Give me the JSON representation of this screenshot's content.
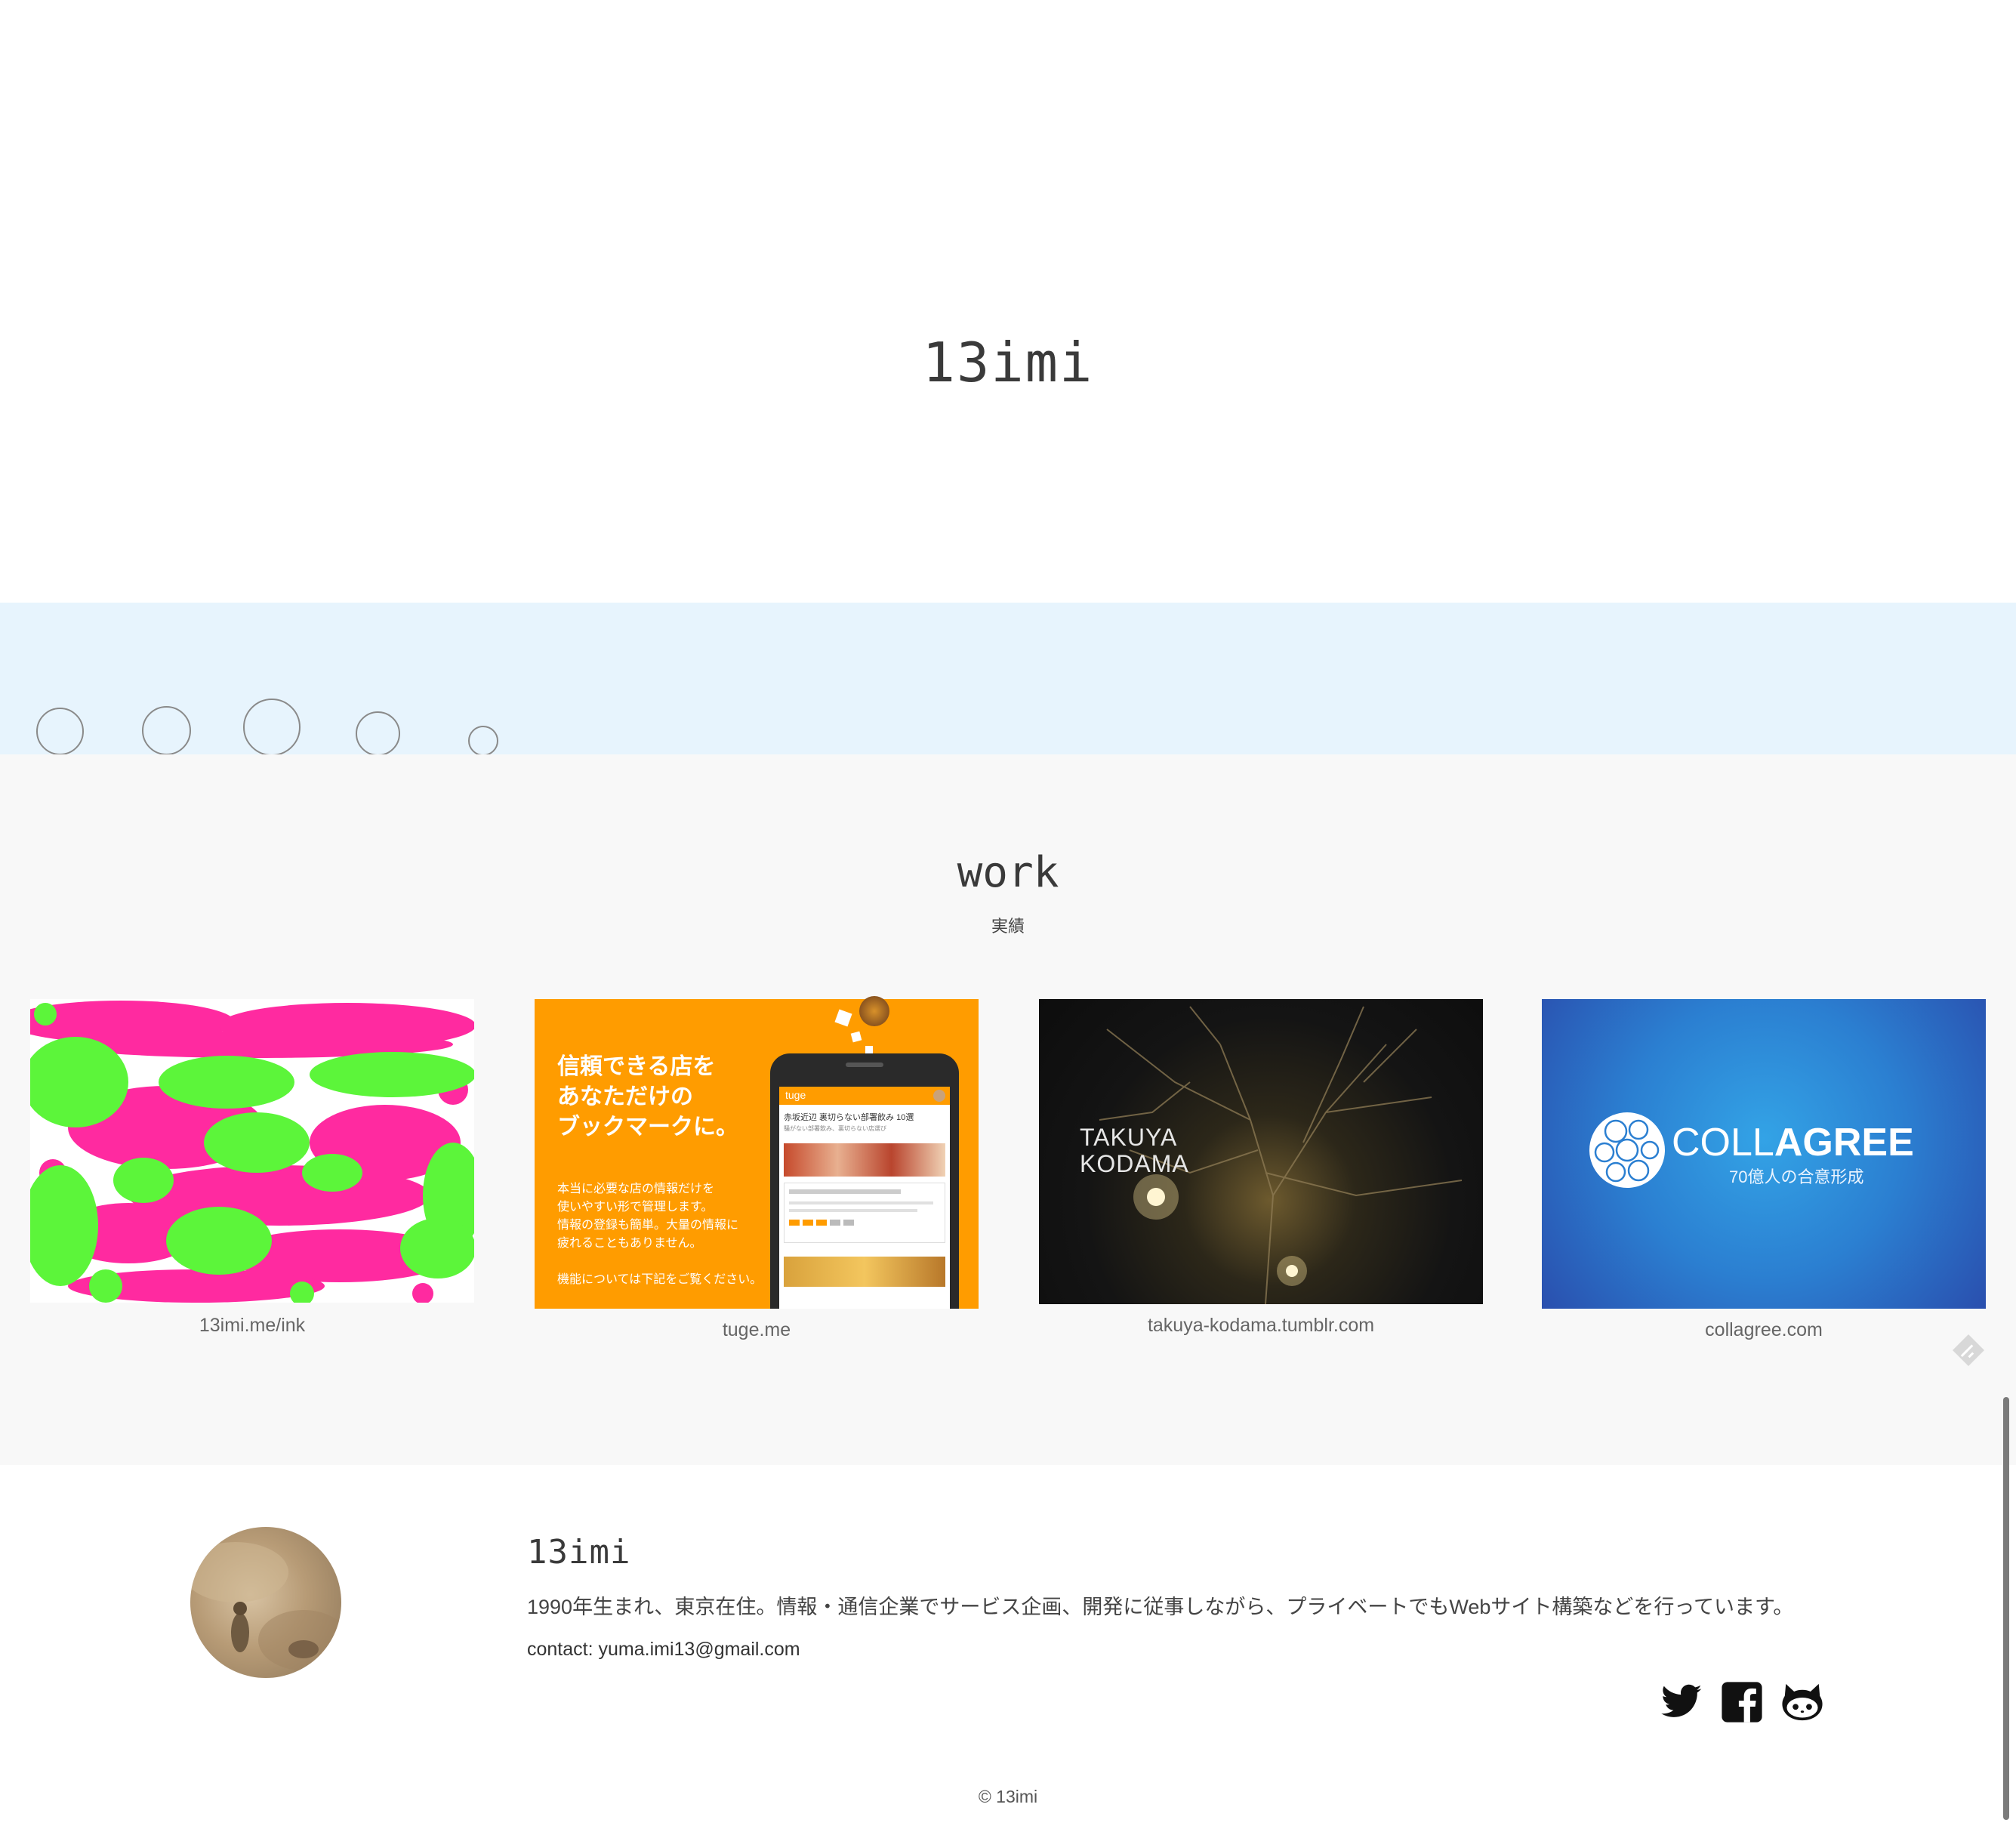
{
  "hero": {
    "title": "13imi"
  },
  "work": {
    "title": "work",
    "subtitle": "実績",
    "items": [
      {
        "caption": "13imi.me/ink"
      },
      {
        "caption": "tuge.me",
        "headline": [
          "信頼できる店を",
          "あなただけの",
          "ブックマークに。"
        ],
        "body": [
          "本当に必要な店の情報だけを",
          "使いやすい形で管理します。",
          "情報の登録も簡単。大量の情報に",
          "疲れることもありません。",
          "",
          "機能については下記をご覧ください。"
        ],
        "app_name": "tuge",
        "app_title": "赤坂近辺 裏切らない部署飲み 10選",
        "app_subtitle": "騒がない部署飲み、裏切らない店選び"
      },
      {
        "caption": "takuya-kodama.tumblr.com",
        "overlay": [
          "TAKUYA",
          "KODAMA"
        ]
      },
      {
        "caption": "collagree.com",
        "logo_light": "COLL",
        "logo_bold": "AGREE",
        "tagline": "70億人の合意形成"
      }
    ]
  },
  "profile": {
    "name": "13imi",
    "description": "1990年生まれ、東京在住。情報・通信企業でサービス企画、開発に従事しながら、プライベートでもWebサイト構築などを行っています。",
    "contact": "contact: yuma.imi13@gmail.com"
  },
  "social": [
    {
      "icon": "twitter-icon"
    },
    {
      "icon": "facebook-icon"
    },
    {
      "icon": "github-icon"
    }
  ],
  "footer": {
    "copyright": "© 13imi"
  },
  "colors": {
    "bubble_band": "#e7f4fd",
    "work_bg": "#f8f8f8",
    "ink_pink": "#ff2aa0",
    "ink_green": "#5cf53a",
    "tuge_orange": "#ff9c00",
    "collagree_blue": "#2b7fd1"
  }
}
